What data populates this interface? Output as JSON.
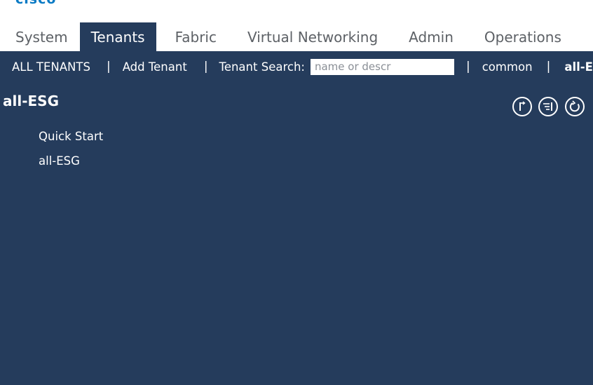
{
  "logo": "cisco",
  "tabs": [
    {
      "label": "System"
    },
    {
      "label": "Tenants"
    },
    {
      "label": "Fabric"
    },
    {
      "label": "Virtual Networking"
    },
    {
      "label": "Admin"
    },
    {
      "label": "Operations"
    }
  ],
  "active_tab": "Tenants",
  "subnav": {
    "all_tenants": "ALL TENANTS",
    "add_tenant": "Add Tenant",
    "search_label": "Tenant Search:",
    "search_placeholder": "name or descr",
    "recent_1": "common",
    "recent_2": "all-ESG",
    "separator": "|"
  },
  "main": {
    "title": "all-ESG",
    "nav_items": [
      "Quick Start",
      "all-ESG"
    ]
  },
  "toolbar": {
    "icons": [
      "jump-back-icon",
      "filter-list-icon",
      "refresh-icon"
    ]
  },
  "colors": {
    "navy": "#253c5c",
    "cisco_blue": "#0a7ac4",
    "tab_text": "#5d6166"
  }
}
